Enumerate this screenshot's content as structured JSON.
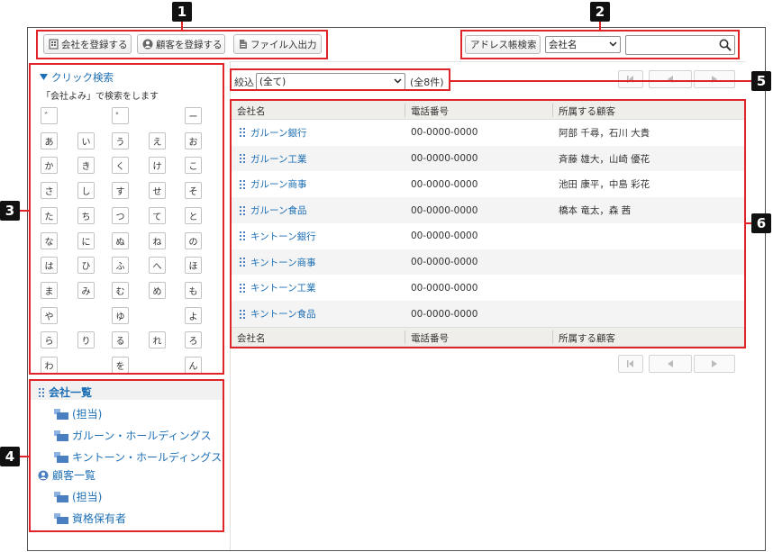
{
  "toolbar": {
    "buttons": [
      {
        "label": "会社を登録する",
        "icon": "building-icon"
      },
      {
        "label": "顧客を登録する",
        "icon": "person-icon"
      },
      {
        "label": "ファイル入出力",
        "icon": "file-icon"
      }
    ]
  },
  "search": {
    "button_label": "アドレス帳検索",
    "field_select": "会社名",
    "query": "",
    "icon": "search-icon"
  },
  "click_search": {
    "title": "クリック検索",
    "description": "「会社よみ」で検索をします",
    "rows": [
      [
        "゛",
        "",
        "゜",
        "",
        "ー"
      ],
      [
        "あ",
        "い",
        "う",
        "え",
        "お"
      ],
      [
        "か",
        "き",
        "く",
        "け",
        "こ"
      ],
      [
        "さ",
        "し",
        "す",
        "せ",
        "そ"
      ],
      [
        "た",
        "ち",
        "つ",
        "て",
        "と"
      ],
      [
        "な",
        "に",
        "ぬ",
        "ね",
        "の"
      ],
      [
        "は",
        "ひ",
        "ふ",
        "へ",
        "ほ"
      ],
      [
        "ま",
        "み",
        "む",
        "め",
        "も"
      ],
      [
        "や",
        "",
        "ゆ",
        "",
        "よ"
      ],
      [
        "ら",
        "り",
        "る",
        "れ",
        "ろ"
      ],
      [
        "わ",
        "",
        "を",
        "",
        "ん"
      ]
    ]
  },
  "tree": {
    "companies_label": "会社一覧",
    "company_items": [
      "(担当)",
      "ガルーン・ホールディングス",
      "キントーン・ホールディングス"
    ],
    "customers_label": "顧客一覧",
    "customer_items": [
      "(担当)",
      "資格保有者"
    ]
  },
  "filter": {
    "label": "絞込",
    "selected": "(全て)",
    "count": "(全8件)"
  },
  "table": {
    "headers": [
      "会社名",
      "電話番号",
      "所属する顧客"
    ],
    "rows": [
      {
        "company": "ガルーン銀行",
        "phone": "00-0000-0000",
        "customers": "阿部 千尋，石川 大貴"
      },
      {
        "company": "ガルーン工業",
        "phone": "00-0000-0000",
        "customers": "斉藤 雄大，山崎 優花"
      },
      {
        "company": "ガルーン商事",
        "phone": "00-0000-0000",
        "customers": "池田 康平，中島 彩花"
      },
      {
        "company": "ガルーン食品",
        "phone": "00-0000-0000",
        "customers": "橋本 竜太，森 茜"
      },
      {
        "company": "キントーン銀行",
        "phone": "00-0000-0000",
        "customers": ""
      },
      {
        "company": "キントーン商事",
        "phone": "00-0000-0000",
        "customers": ""
      },
      {
        "company": "キントーン工業",
        "phone": "00-0000-0000",
        "customers": ""
      },
      {
        "company": "キントーン食品",
        "phone": "00-0000-0000",
        "customers": ""
      }
    ]
  },
  "callouts": [
    "1",
    "2",
    "3",
    "4",
    "5",
    "6"
  ],
  "colors": {
    "callout_border": "#e0242a",
    "link": "#1d6fb5",
    "header_bg": "#f0eee8"
  }
}
